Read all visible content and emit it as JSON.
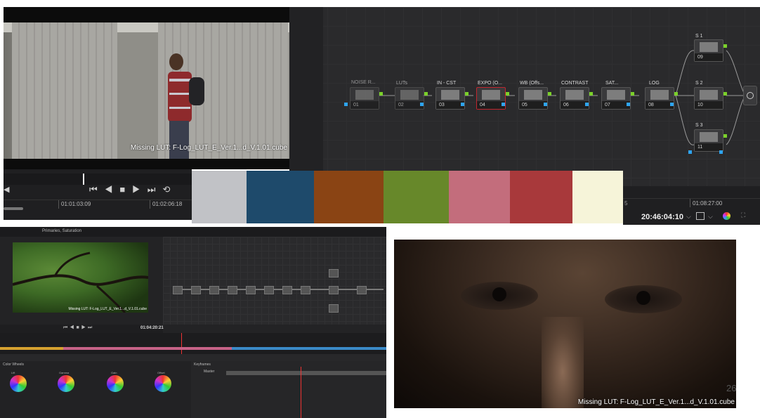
{
  "viewer_top": {
    "caption": "Missing LUT: F-Log_LUT_E_Ver.1...d_V.1.01.cube"
  },
  "node_graph": {
    "nodes": [
      {
        "label": "NOISE R...",
        "num": "01"
      },
      {
        "label": "LUTs",
        "num": "02"
      },
      {
        "label": "IN - CST",
        "num": "03"
      },
      {
        "label": "EXPO (O...",
        "num": "04"
      },
      {
        "label": "WB (Offs...",
        "num": "05"
      },
      {
        "label": "CONTRAST",
        "num": "06"
      },
      {
        "label": "SAT...",
        "num": "07"
      },
      {
        "label": "LOG",
        "num": "08"
      },
      {
        "label": "S 1",
        "num": "09"
      },
      {
        "label": "S 2",
        "num": "10"
      },
      {
        "label": "S 3",
        "num": "11"
      }
    ]
  },
  "transport": {
    "tc_left": "01:01:03:09",
    "tc_right": "01:02:06:18"
  },
  "palette": {
    "colors": [
      "#c1c2c6",
      "#1e4a6b",
      "#8a4414",
      "#67882a",
      "#c36d7c",
      "#a8393b",
      "#f6f4d9"
    ]
  },
  "right_strip": {
    "tc_marker": "01:08:27:00",
    "timecode": "20:46:04:10",
    "tick": "5"
  },
  "ui_small": {
    "tab_title": "Primaries, Saturation",
    "timecode": "01:04:20:21",
    "viewer_caption": "Missing LUT: F-Log_LUT_E_Ver.1...d_V.1.01.cube",
    "wheels_title": "Color Wheels",
    "wheel_labels": [
      "Lift",
      "Gamma",
      "Gain",
      "Offset"
    ],
    "keyframes_title": "Keyframes",
    "master_label": "Master"
  },
  "viewer_bottom": {
    "caption": "Missing LUT: F-Log_LUT_E_Ver.1...d_V.1.01.cube"
  },
  "page_number": "26"
}
